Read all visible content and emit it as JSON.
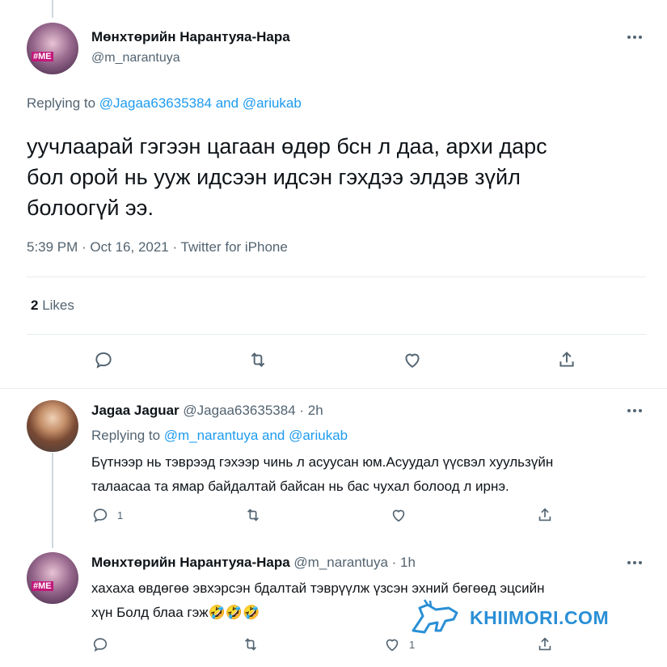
{
  "main_tweet": {
    "display_name": "Мөнхтөрийн Нарантуяа-Нара",
    "handle": "@m_narantuya",
    "replying_prefix": "Replying to",
    "replying_targets": "@Jagaa63635384 and @ariukab",
    "text_lines": [
      "уучлаарай гэгээн цагаан өдөр бсн л даа, архи дарс",
      "бол орой нь ууж идсээн идсэн гэхдээ элдэв зүйл",
      "болоогүй ээ."
    ],
    "meta": "5:39 PM · Oct 16, 2021 · Twitter for iPhone",
    "likes_count": "2",
    "likes_label": "Likes"
  },
  "reply_1": {
    "display_name": "Jagaa Jaguar",
    "handle_time": "@Jagaa63635384 · 2h",
    "replying_prefix": "Replying to",
    "replying_targets": "@m_narantuya and @ariukab",
    "text_lines": [
      "Бүтнээр нь тэврээд гэхээр чинь л асуусан юм.Асуудал үүсвэл хуульзүйн",
      "талаасаа та ямар байдалтай байсан нь бас чухал болоод л ирнэ."
    ],
    "reply_count": "1"
  },
  "reply_2": {
    "display_name": "Мөнхтөрийн Нарантуяа-Нара",
    "handle_time": "@m_narantuya · 1h",
    "text_lines": [
      "хахаха өвдөгөө эвхэрсэн бдалтай тэврүүлж үзсэн эхний бөгөөд эцсийн",
      "хүн Болд блаа гэж🤣🤣🤣"
    ],
    "like_count": "1"
  },
  "avatar_badge": "#ME",
  "watermark": "KHIIMORI.COM",
  "colors": {
    "link": "#1d9bf0",
    "muted": "#536471",
    "divider": "#e6ecf0",
    "watermark": "#2a8fd6"
  }
}
